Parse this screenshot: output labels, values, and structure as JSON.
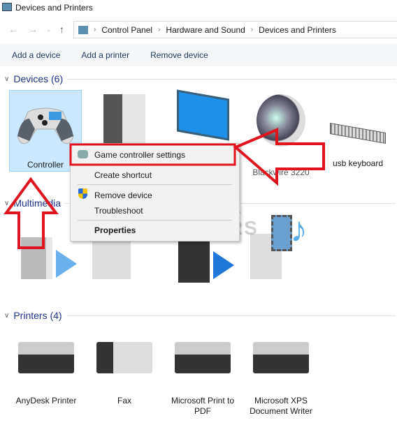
{
  "window": {
    "title": "Devices and Printers"
  },
  "address": {
    "crumbs": [
      "Control Panel",
      "Hardware and Sound",
      "Devices and Printers"
    ]
  },
  "toolbar": {
    "add_device": "Add a device",
    "add_printer": "Add a printer",
    "remove_device": "Remove device"
  },
  "devices": {
    "header": "Devices (6)",
    "items": [
      {
        "label": "Controller",
        "icon": "gamepad-icon"
      },
      {
        "label": "",
        "icon": "computer-tower-icon"
      },
      {
        "label": "",
        "icon": "monitor-icon"
      },
      {
        "label": "Blackwire 3220",
        "icon": "speaker-icon"
      },
      {
        "label": "usb keyboard",
        "icon": "keyboard-icon"
      }
    ]
  },
  "multimedia": {
    "header": "Multimedia"
  },
  "printers": {
    "header": "Printers (4)",
    "items": [
      {
        "label": "AnyDesk Printer"
      },
      {
        "label": "Fax"
      },
      {
        "label": "Microsoft Print to PDF"
      },
      {
        "label": "Microsoft XPS Document Writer"
      }
    ]
  },
  "context_menu": {
    "items": [
      "Game controller settings",
      "Create shortcut",
      "Remove device",
      "Troubleshoot",
      "Properties"
    ]
  },
  "watermark": "TECH 4 GAMERS",
  "colors": {
    "annotation": "#e0141e",
    "selection": "#cce8ff",
    "accent": "#1e3287"
  }
}
